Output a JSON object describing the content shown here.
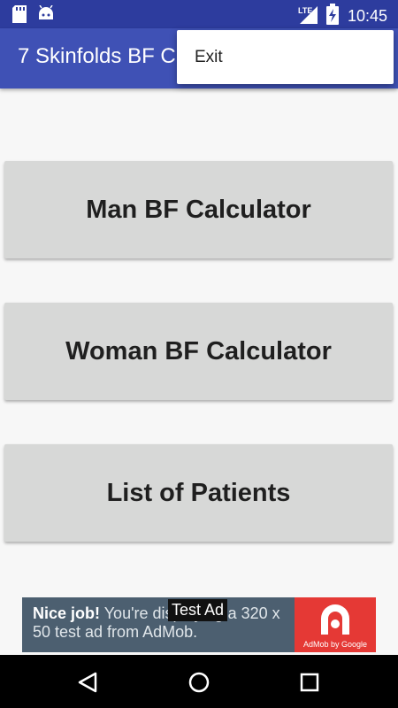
{
  "status_bar": {
    "network": "LTE",
    "time": "10:45",
    "icons": [
      "sd-card-icon",
      "android-icon",
      "lte-signal-icon",
      "battery-charging-icon"
    ]
  },
  "app_bar": {
    "title": "7 Skinfolds BF C"
  },
  "overflow_menu": {
    "items": [
      "Exit"
    ]
  },
  "main": {
    "buttons": [
      {
        "label": "Man BF Calculator"
      },
      {
        "label": "Woman BF Calculator"
      },
      {
        "label": "List of Patients"
      }
    ]
  },
  "ad": {
    "headline": "Nice job!",
    "body": "You're displaying a 320 x 50 test ad from AdMob.",
    "label": "Test Ad",
    "brand": "AdMob by Google"
  },
  "nav_bar": {
    "icons": [
      "back-icon",
      "home-icon",
      "recents-icon"
    ]
  },
  "colors": {
    "status_bar": "#2d3c9e",
    "app_bar": "#3f51b5",
    "button_bg": "#d7d8d7",
    "ad_bg": "#4c5f70",
    "admob_red": "#e53935"
  }
}
